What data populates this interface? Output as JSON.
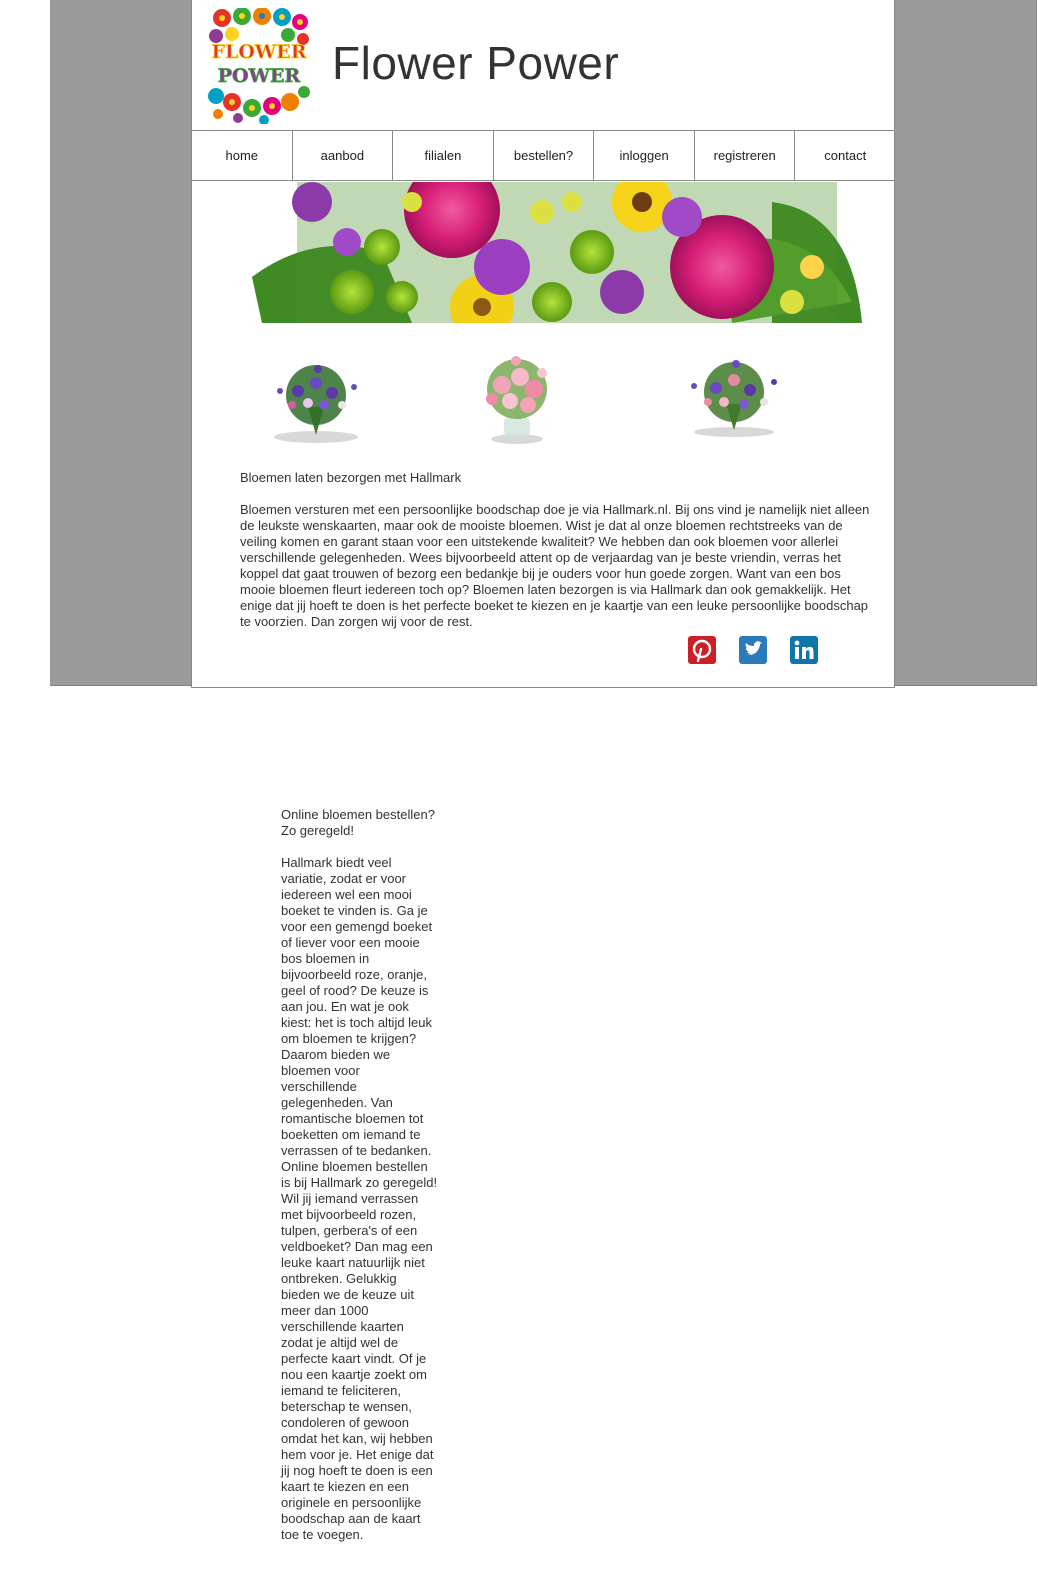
{
  "site": {
    "title": "Flower Power",
    "logo_text_line1": "FLOWER",
    "logo_text_line2": "POWER"
  },
  "nav": {
    "items": [
      {
        "label": "home"
      },
      {
        "label": "aanbod"
      },
      {
        "label": "filialen"
      },
      {
        "label": "bestellen?"
      },
      {
        "label": "inloggen"
      },
      {
        "label": "registreren"
      },
      {
        "label": "contact"
      }
    ]
  },
  "intro": {
    "title": "Bloemen laten bezorgen met Hallmark",
    "text": "Bloemen versturen met een persoonlijke boodschap doe je via Hallmark.nl. Bij ons vind je namelijk niet alleen de leukste wenskaarten, maar ook de mooiste bloemen. Wist je dat al onze bloemen rechtstreeks van de veiling komen en garant staan voor een uitstekende kwaliteit? We hebben dan ook bloemen voor allerlei verschillende gelegenheden. Wees bijvoorbeeld attent op de verjaardag van je beste vriendin, verras het koppel dat gaat trouwen of bezorg een bedankje bij je ouders voor hun goede zorgen. Want van een bos mooie bloemen fleurt iedereen toch op? Bloemen laten bezorgen is via Hallmark dan ook gemakkelijk. Het enige dat jij hoeft te doen is het perfecte boeket te kiezen en je kaartje van een leuke persoonlijke boodschap te voorzien. Dan zorgen wij voor de rest."
  },
  "social": {
    "pinterest_color": "#cb2027",
    "twitter_color": "#2b7bb9",
    "linkedin_color": "#0e76a8"
  },
  "second": {
    "title": "Online bloemen bestellen? Zo geregeld!",
    "text": "Hallmark biedt veel variatie, zodat er voor iedereen wel een mooi boeket te vinden is. Ga je voor een gemengd boeket of liever voor een mooie bos bloemen in bijvoorbeeld roze, oranje, geel of rood? De keuze is aan jou. En wat je ook kiest: het is toch altijd leuk om bloemen te krijgen? Daarom bieden we bloemen voor verschillende gelegenheden. Van romantische bloemen tot boeketten om iemand te verrassen of te bedanken. Online bloemen bestellen is bij Hallmark zo geregeld! Wil jij iemand verrassen met bijvoorbeeld rozen, tulpen, gerbera's of een veldboeket? Dan mag een leuke kaart natuurlijk niet ontbreken. Gelukkig bieden we de keuze uit meer dan 1000 verschillende kaarten zodat je altijd wel de perfecte kaart vindt. Of je nou een kaartje zoekt om iemand te feliciteren, beterschap te wensen, condoleren of gewoon omdat het kan, wij hebben hem voor je. Het enige dat jij nog hoeft te doen is een kaart te kiezen en een originele en persoonlijke boodschap aan de kaart toe te voegen."
  }
}
